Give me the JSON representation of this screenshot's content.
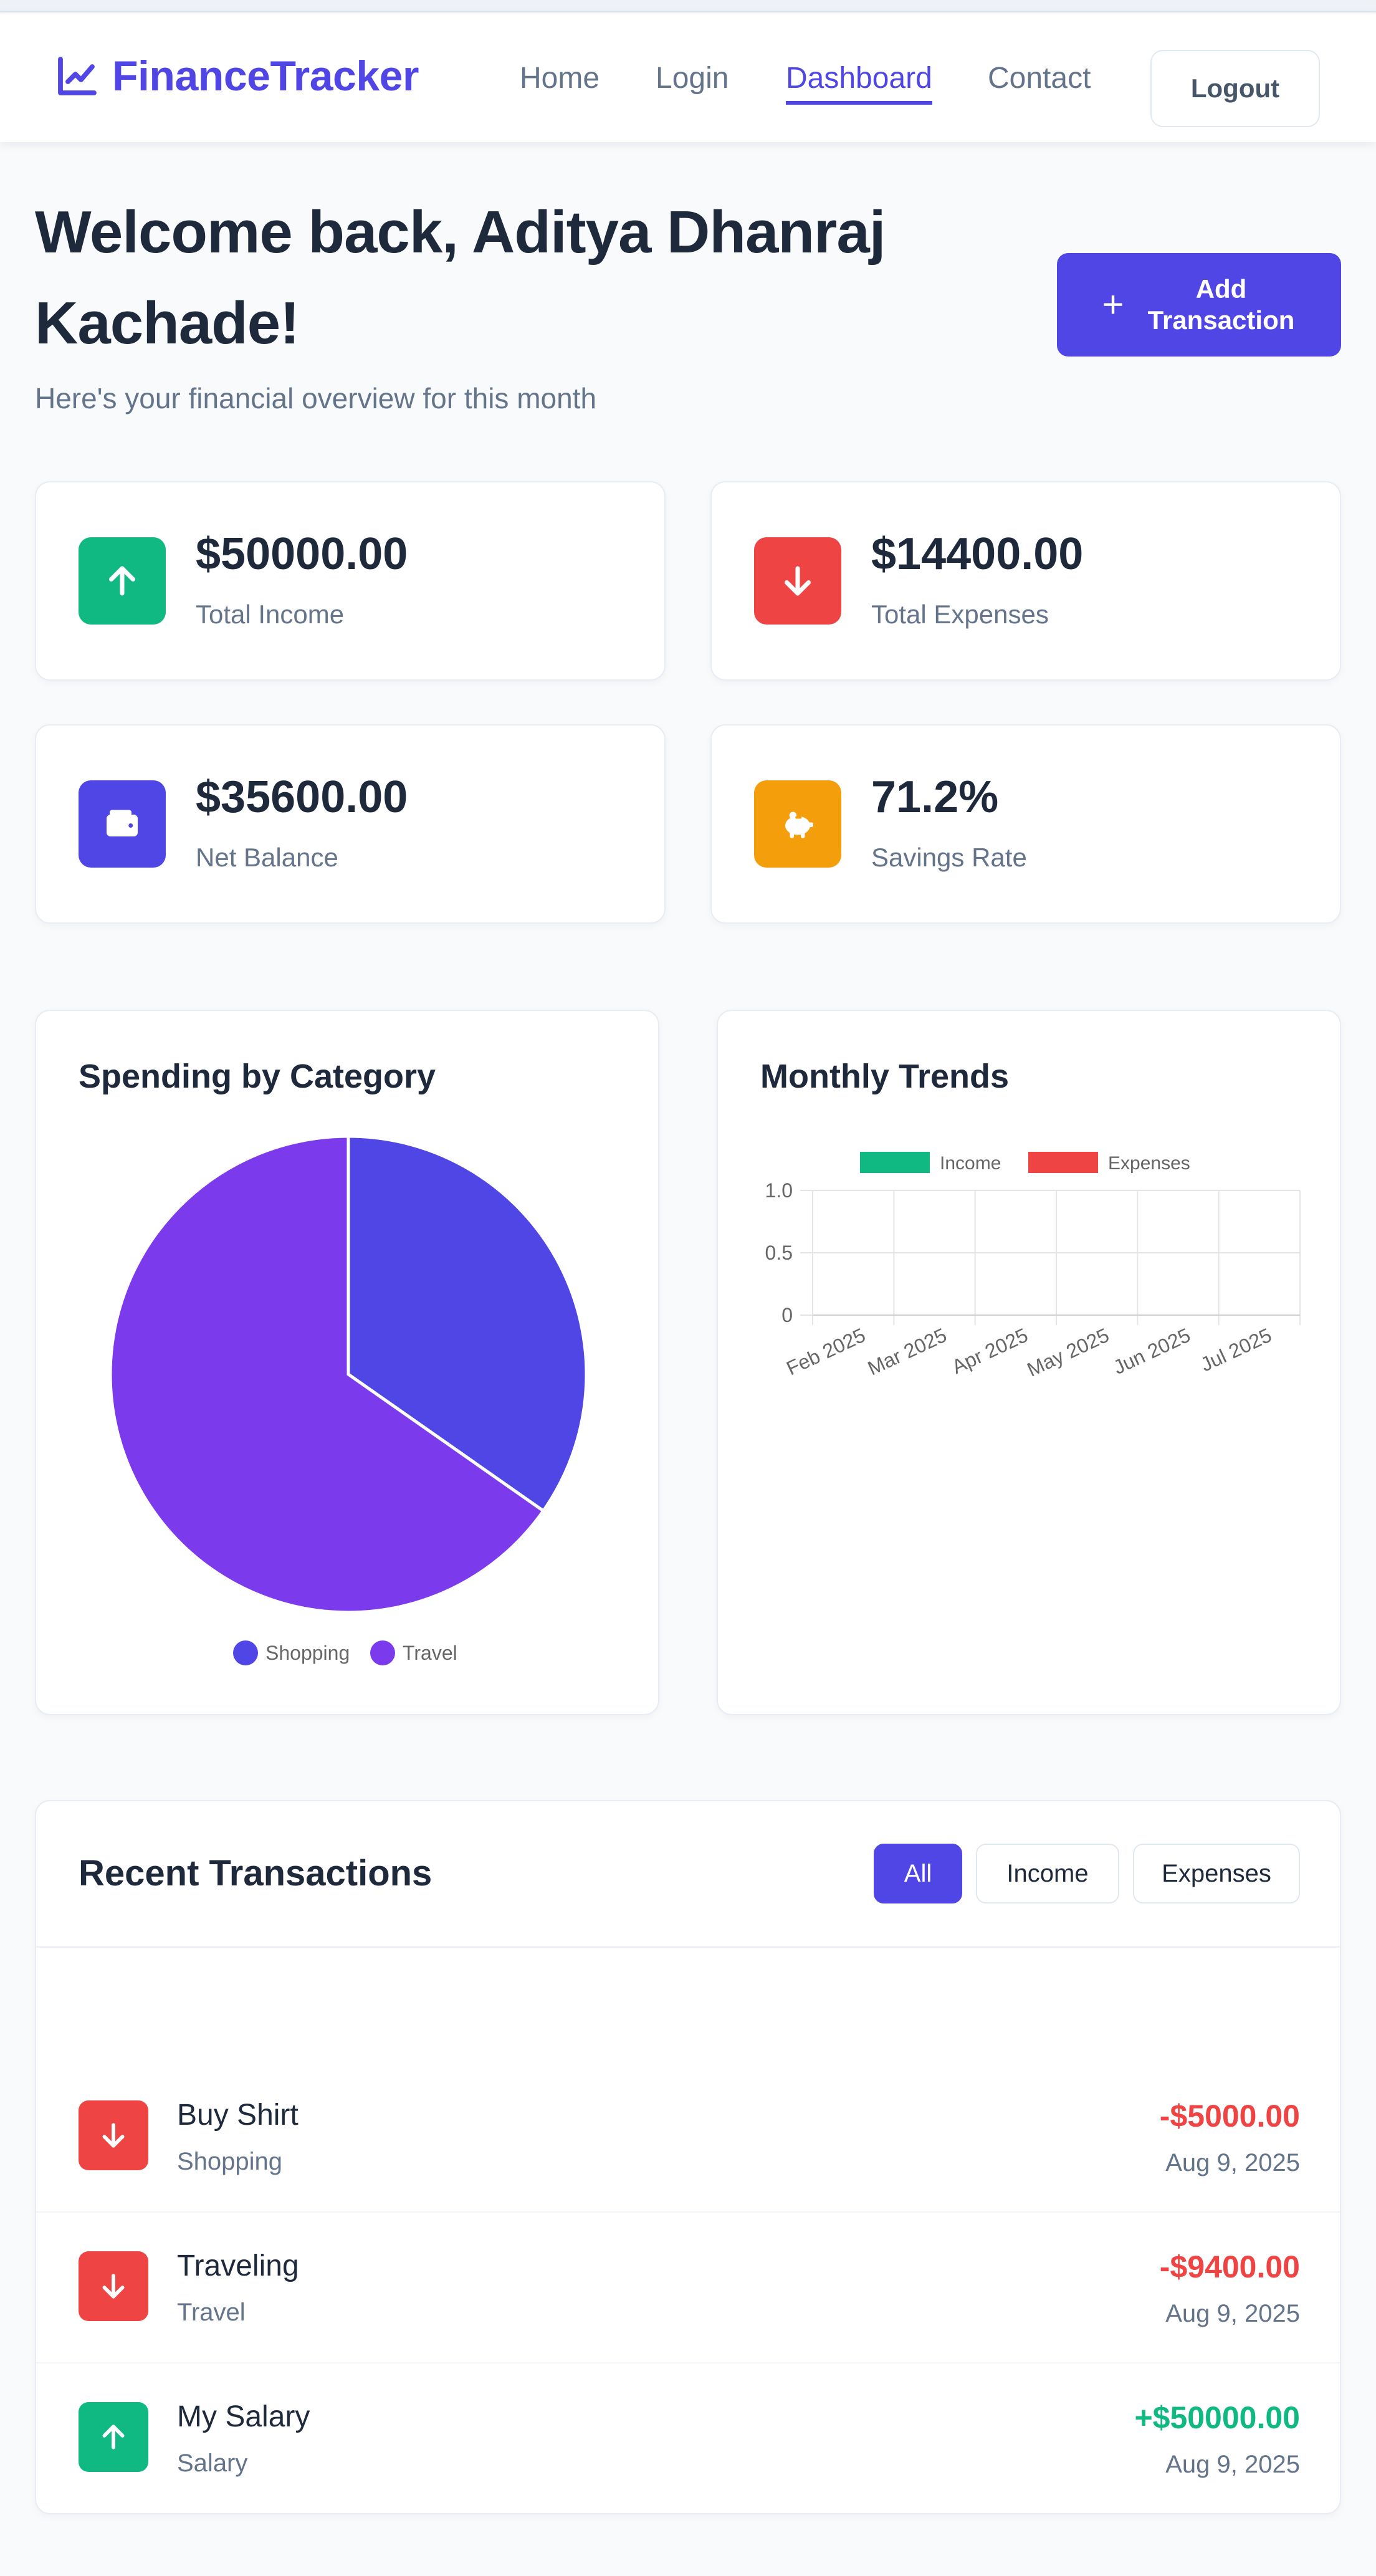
{
  "brand": {
    "name": "FinanceTracker",
    "color": "#4f46e5"
  },
  "nav": {
    "links": [
      {
        "label": "Home",
        "active": false
      },
      {
        "label": "Login",
        "active": false
      },
      {
        "label": "Dashboard",
        "active": true
      },
      {
        "label": "Contact",
        "active": false
      }
    ],
    "logout_label": "Logout"
  },
  "header": {
    "welcome": "Welcome back, Aditya Dhanraj Kachade!",
    "subtitle": "Here's your financial overview for this month",
    "add_button_label": "Add Transaction"
  },
  "stats": [
    {
      "value": "$50000.00",
      "label": "Total Income",
      "icon": "arrow-up-icon",
      "color": "#10b981"
    },
    {
      "value": "$14400.00",
      "label": "Total Expenses",
      "icon": "arrow-down-icon",
      "color": "#ef4444"
    },
    {
      "value": "$35600.00",
      "label": "Net Balance",
      "icon": "wallet-icon",
      "color": "#4f46e5"
    },
    {
      "value": "71.2%",
      "label": "Savings Rate",
      "icon": "piggy-bank-icon",
      "color": "#f59e0b"
    }
  ],
  "charts": {
    "spending_title": "Spending by Category",
    "trends_title": "Monthly Trends"
  },
  "chart_data": [
    {
      "type": "pie",
      "title": "Spending by Category",
      "categories": [
        "Shopping",
        "Travel"
      ],
      "values": [
        5000,
        9400
      ],
      "colors": [
        "#4f46e5",
        "#7c3aed"
      ],
      "legend": "bottom"
    },
    {
      "type": "bar",
      "title": "Monthly Trends",
      "categories": [
        "Feb 2025",
        "Mar 2025",
        "Apr 2025",
        "May 2025",
        "Jun 2025",
        "Jul 2025"
      ],
      "series": [
        {
          "name": "Income",
          "values": [
            0,
            0,
            0,
            0,
            0,
            0
          ],
          "color": "#10b981"
        },
        {
          "name": "Expenses",
          "values": [
            0,
            0,
            0,
            0,
            0,
            0
          ],
          "color": "#ef4444"
        }
      ],
      "yticks": [
        "1.0",
        "0.5",
        "0"
      ],
      "ylim": [
        0,
        1
      ],
      "grid": true,
      "legend": "top"
    }
  ],
  "transactions": {
    "title": "Recent Transactions",
    "filters": [
      {
        "label": "All",
        "active": true
      },
      {
        "label": "Income",
        "active": false
      },
      {
        "label": "Expenses",
        "active": false
      }
    ],
    "items": [
      {
        "name": "Buy Shirt",
        "category": "Shopping",
        "amount": "-$5000.00",
        "date": "Aug 9, 2025",
        "type": "expense"
      },
      {
        "name": "Traveling",
        "category": "Travel",
        "amount": "-$9400.00",
        "date": "Aug 9, 2025",
        "type": "expense"
      },
      {
        "name": "My Salary",
        "category": "Salary",
        "amount": "+$50000.00",
        "date": "Aug 9, 2025",
        "type": "income"
      }
    ]
  },
  "colors": {
    "income": "#10b981",
    "expense": "#ef4444",
    "accent": "#4f46e5",
    "text": "#1e293b",
    "muted": "#64748b"
  }
}
